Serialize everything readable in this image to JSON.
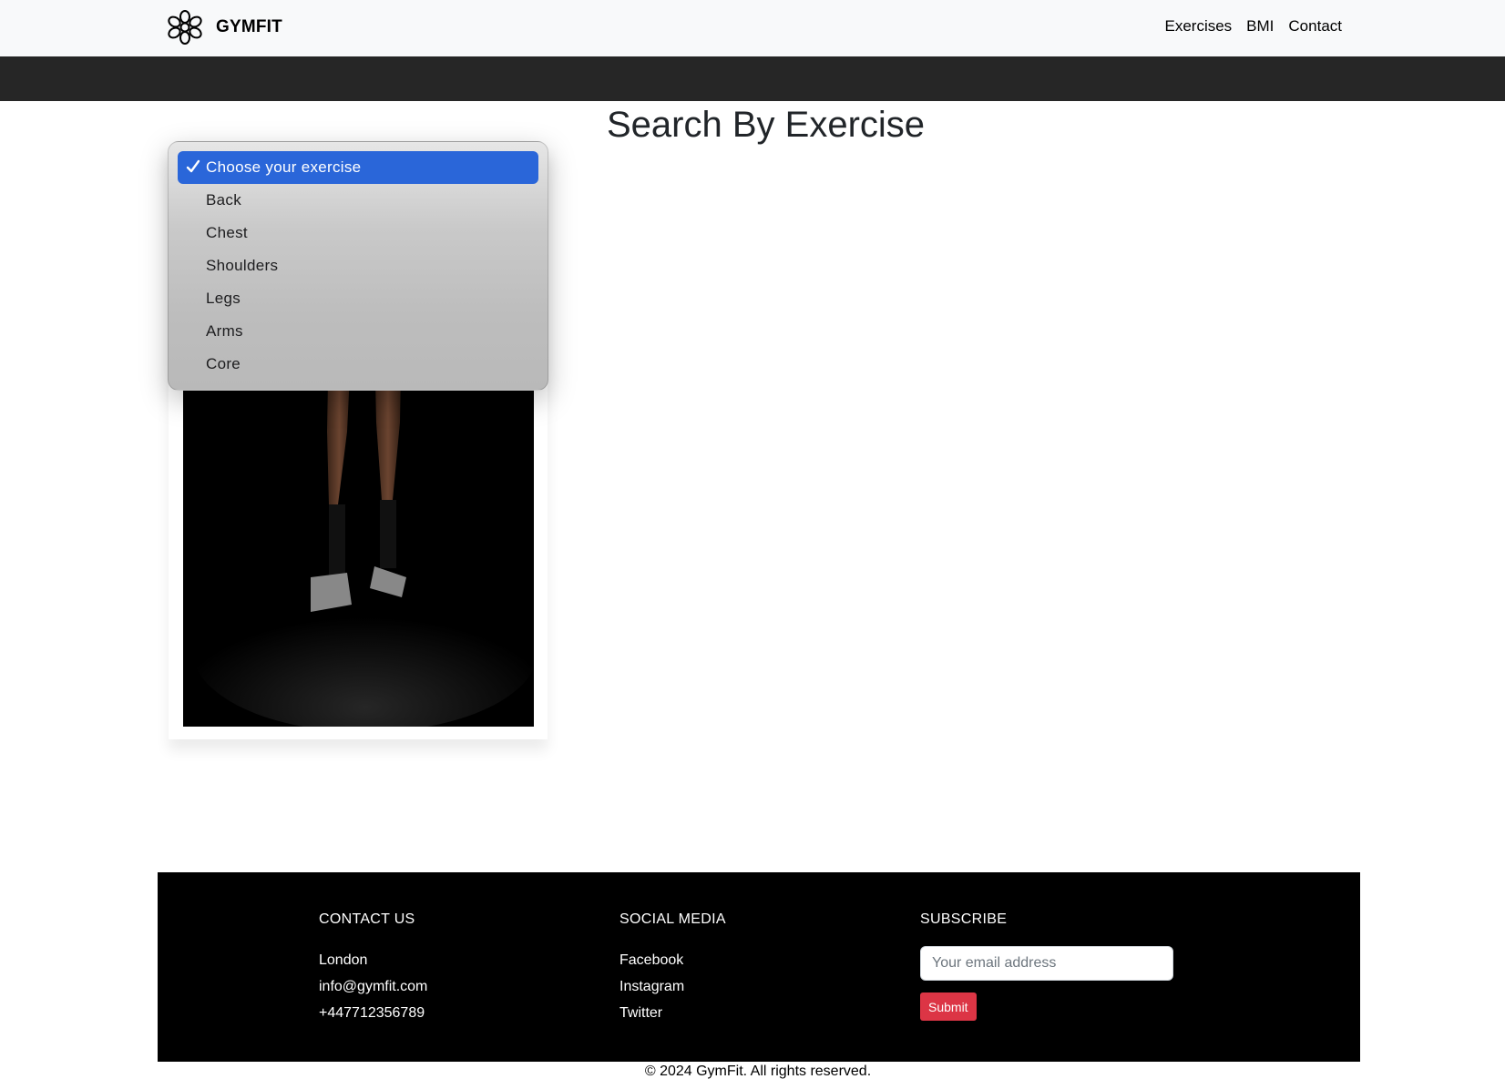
{
  "navbar": {
    "brand": "GYMFIT",
    "logo_icon": "flower-logo-icon",
    "links": [
      "Exercises",
      "BMI",
      "Contact"
    ]
  },
  "main": {
    "title": "Search By Exercise",
    "select": {
      "selected": "Choose your exercise",
      "options": [
        "Choose your exercise",
        "Back",
        "Chest",
        "Shoulders",
        "Legs",
        "Arms",
        "Core"
      ],
      "selected_color": "#2a66d9"
    },
    "card_image": "athlete-with-dumbbells-image"
  },
  "footer": {
    "contact": {
      "heading": "CONTACT US",
      "lines": [
        "London",
        "info@gymfit.com",
        "+447712356789"
      ]
    },
    "social": {
      "heading": "SOCIAL MEDIA",
      "links": [
        "Facebook",
        "Instagram",
        "Twitter"
      ]
    },
    "subscribe": {
      "heading": "SUBSCRIBE",
      "placeholder": "Your email address",
      "button": "Submit",
      "button_color": "#dc3545"
    },
    "copyright": "© 2024 GymFit. All rights reserved."
  }
}
